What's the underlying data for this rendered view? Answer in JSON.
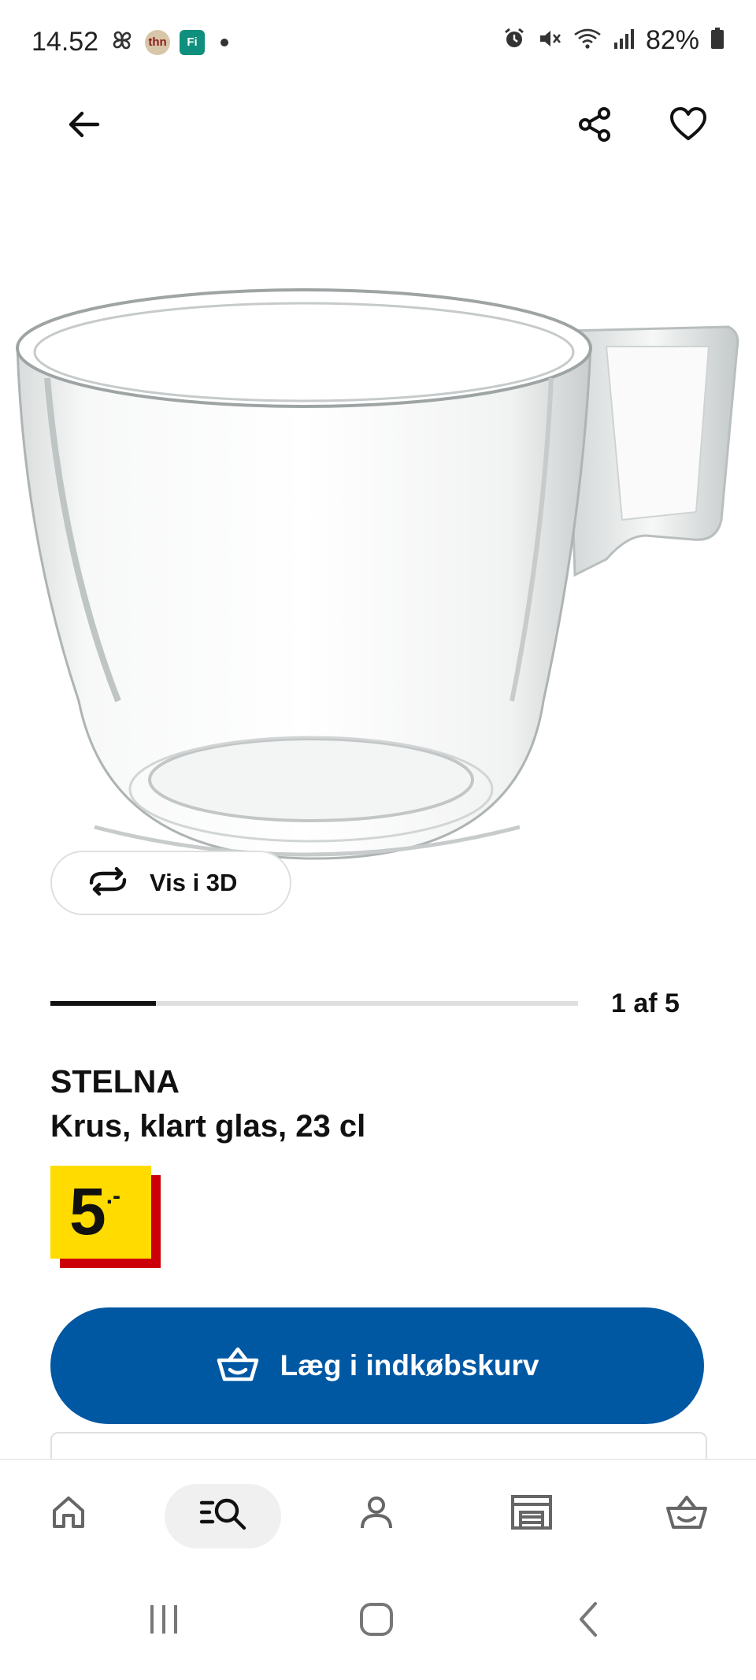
{
  "status_bar": {
    "time": "14.52",
    "left_icons": [
      "pinwheel-icon",
      "thn-app-icon",
      "fi-app-icon",
      "notification-dot"
    ],
    "thn_label": "thn",
    "fi_label": "Fi",
    "right_icons": [
      "alarm-icon",
      "mute-icon",
      "wifi-icon",
      "signal-icon",
      "battery-icon"
    ],
    "battery": "82%"
  },
  "top_bar": {
    "back_icon": "arrow-left-icon",
    "share_icon": "share-icon",
    "favorite_icon": "heart-icon"
  },
  "gallery": {
    "view_3d_label": "Vis i 3D",
    "counter": "1 af 5",
    "progress": 0.2
  },
  "product": {
    "name": "STELNA",
    "description": "Krus, klart glas, 23 cl",
    "price_main": "5",
    "price_suffix": ".-"
  },
  "actions": {
    "add_to_cart_label": "Læg i indkøbskurv"
  },
  "bottom_nav": {
    "items": [
      "home-icon",
      "search-icon",
      "profile-icon",
      "store-icon",
      "basket-icon"
    ],
    "active": "search-icon"
  },
  "system_nav": [
    "recent-apps-icon",
    "home-button-icon",
    "back-icon"
  ],
  "colors": {
    "primary": "#0058a3",
    "price_yellow": "#ffdb00",
    "price_red": "#cc0008"
  }
}
